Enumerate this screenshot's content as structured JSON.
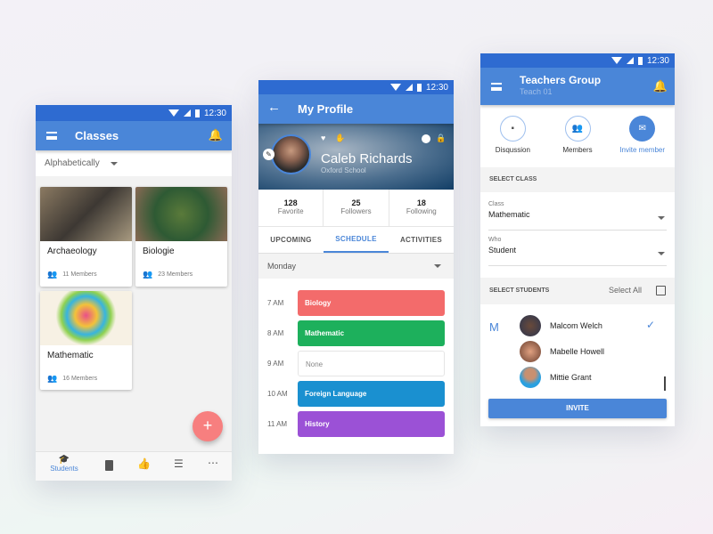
{
  "status_time": "12:30",
  "classes": {
    "title": "Classes",
    "sort": "Alphabetically",
    "cards": [
      {
        "title": "Archaeology",
        "members": "11 Members"
      },
      {
        "title": "Biologie",
        "members": "23 Members"
      },
      {
        "title": "Mathematic",
        "members": "16 Members"
      }
    ],
    "fab": "+",
    "nav": [
      {
        "label": "Students",
        "icon": "graduation-cap-icon"
      },
      {
        "icon": "document-icon"
      },
      {
        "icon": "thumbs-up-icon"
      },
      {
        "icon": "list-icon"
      },
      {
        "icon": "more-icon"
      }
    ],
    "accent": "#4a86d8",
    "fab_color": "#f77f7f"
  },
  "profile": {
    "title": "My Profile",
    "name": "Caleb Richards",
    "school": "Oxford School",
    "stats": [
      {
        "value": "128",
        "label": "Favorite"
      },
      {
        "value": "25",
        "label": "Followers"
      },
      {
        "value": "18",
        "label": "Following"
      }
    ],
    "tabs": [
      "UPCOMING",
      "SCHEDULE",
      "ACTIVITIES"
    ],
    "active_tab": "SCHEDULE",
    "day": "Monday",
    "schedule": [
      {
        "time": "7 AM",
        "subject": "Biology",
        "color": "#f36b6b"
      },
      {
        "time": "8 AM",
        "subject": "Mathematic",
        "color": "#1db05c"
      },
      {
        "time": "9 AM",
        "subject": "None",
        "color": "#ffffff"
      },
      {
        "time": "10 AM",
        "subject": "Foreign Language",
        "color": "#1a90d0"
      },
      {
        "time": "11 AM",
        "subject": "History",
        "color": "#9b51d6"
      }
    ]
  },
  "group": {
    "title": "Teachers Group",
    "subtitle": "Teach 01",
    "actions": [
      {
        "label": "Disqussion",
        "icon": "chat-icon"
      },
      {
        "label": "Members",
        "icon": "people-icon"
      },
      {
        "label": "Invite member",
        "icon": "mail-icon",
        "active": true
      }
    ],
    "select_class": "SELECT CLASS",
    "class_label": "Class",
    "class_value": "Mathematic",
    "who_label": "Who",
    "who_value": "Student",
    "select_students": "SELECT STUDENTS",
    "select_all": "Select All",
    "letter": "M",
    "students": [
      {
        "name": "Malcom Welch",
        "checked": true
      },
      {
        "name": "Mabelle Howell",
        "checked": false
      },
      {
        "name": "Mittie Grant",
        "checked": false
      }
    ],
    "invite": "INVITE"
  }
}
